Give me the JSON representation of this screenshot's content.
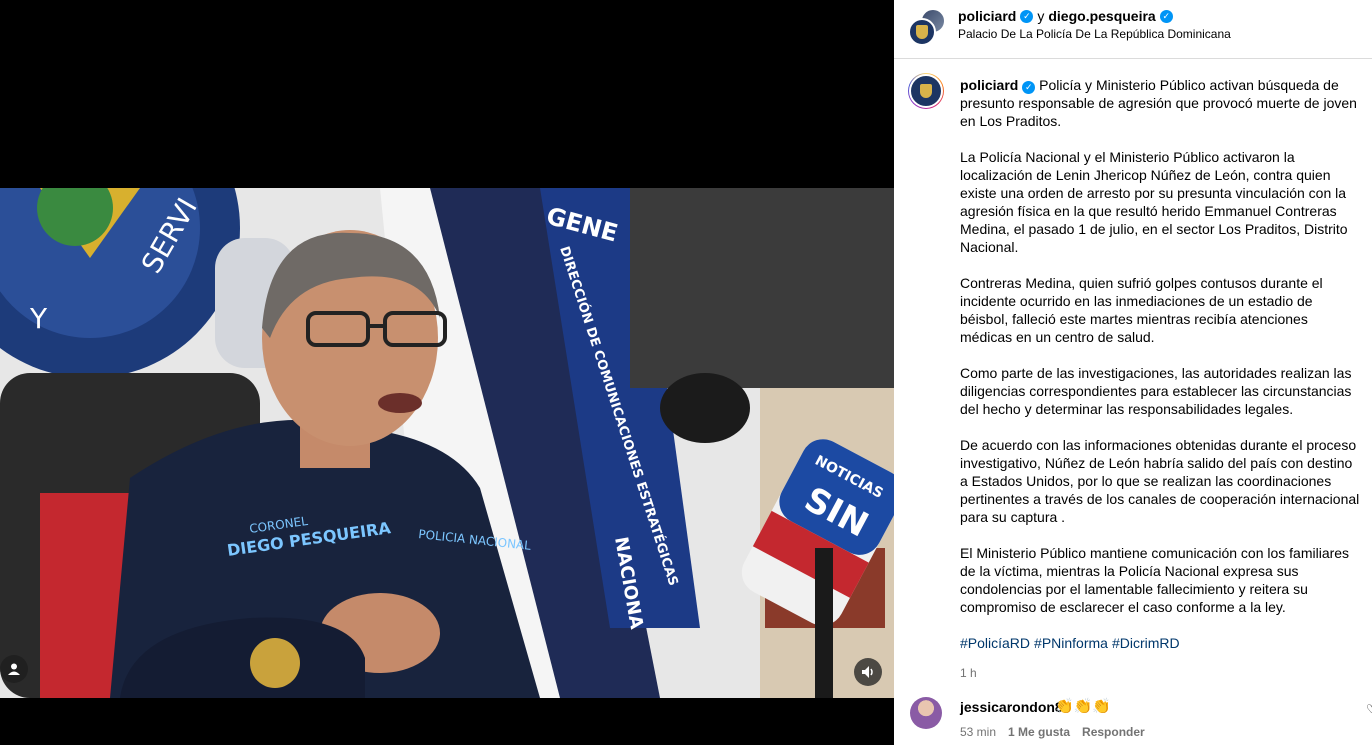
{
  "header": {
    "user1": "policiard",
    "conjunction": "y",
    "user2": "diego.pesqueira",
    "location": "Palacio De La Policía De La República Dominicana"
  },
  "post": {
    "author": "policiard",
    "paragraphs": [
      "Policía y Ministerio Público activan búsqueda de presunto responsable de agresión que provocó muerte de joven en Los Praditos.",
      "La Policía Nacional y el Ministerio Público activaron la localización de Lenin Jhericop Núñez de León, contra quien existe una orden de arresto por su presunta vinculación con la agresión física en la que resultó herido Emmanuel Contreras Medina, el pasado 1 de julio, en el sector Los Praditos, Distrito Nacional.",
      "Contreras Medina, quien sufrió golpes contusos durante el incidente ocurrido en las inmediaciones de un estadio de béisbol, falleció este martes mientras recibía atenciones médicas en un centro de salud.",
      "Como parte de las investigaciones, las autoridades realizan las diligencias correspondientes para establecer las circunstancias del hecho y determinar las responsabilidades legales.",
      "De acuerdo con las informaciones obtenidas durante el proceso investigativo, Núñez de León habría salido del país con destino a Estados Unidos, por lo que se realizan las coordinaciones pertinentes a través de los canales de cooperación internacional para su captura .",
      "El Ministerio Público mantiene comunicación con los familiares de la víctima, mientras la Policía Nacional expresa sus condolencias por el lamentable fallecimiento y reitera su compromiso de esclarecer el caso conforme a la ley."
    ],
    "hashtags": [
      "#PolicíaRD",
      "#PNinforma",
      "#DicrimRD"
    ],
    "time_ago": "1 h"
  },
  "comment": {
    "user": "jessicarondon8",
    "text": "👏👏👏",
    "time": "53 min",
    "likes": "1 Me gusta",
    "reply": "Responder"
  },
  "video": {
    "scene_texts": {
      "shirt_name_1": "CORONEL",
      "shirt_name_2": "DIEGO PESQUEIRA",
      "shirt_badge": "POLICIA NACIONAL",
      "mic_label_1": "NOTICIAS",
      "mic_label_2": "SIN",
      "wall_y": "Y",
      "wall_serv": "SERVI",
      "banner": "DIRECCIÓN DE COMUNICACIONES ESTRATÉGICAS",
      "banner_top": "GENE",
      "flag_text": "NACIONA"
    }
  },
  "colors": {
    "verified": "#0095f6",
    "hashtag": "#00376b",
    "muted": "#737373",
    "uniform": "#18233d"
  }
}
